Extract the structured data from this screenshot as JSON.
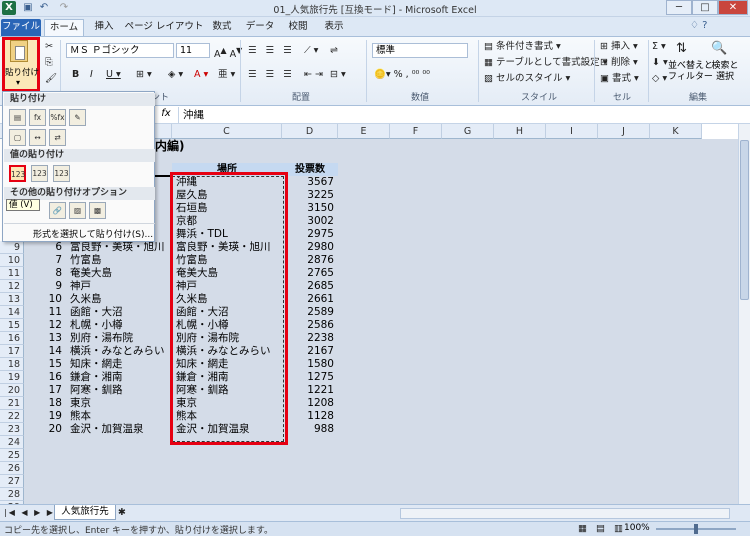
{
  "window": {
    "title": "01_人気旅行先 [互換モード] - Microsoft Excel",
    "logo": "X",
    "controls": [
      "─",
      "□",
      "✕"
    ]
  },
  "tabs": [
    "ファイル",
    "ホーム",
    "挿入",
    "ページ レイアウト",
    "数式",
    "データ",
    "校閲",
    "表示"
  ],
  "ribbon": {
    "paste_label": "貼り付け",
    "font_name": "ＭＳ Ｐゴシック",
    "font_size": "11",
    "number_format": "標準",
    "conditional_format": "条件付き書式",
    "format_as_table": "テーブルとして書式設定",
    "cell_styles": "セルのスタイル",
    "insert": "挿入",
    "delete": "削除",
    "format": "書式",
    "sort_filter": "並べ替えと\nフィルター",
    "find_select": "検索と\n選択",
    "groups": {
      "font": "フォント",
      "alignment": "配置",
      "number": "数値",
      "styles": "スタイル",
      "cells": "セル",
      "editing": "編集"
    }
  },
  "formula_bar": {
    "fx": "fx",
    "content": "沖縄"
  },
  "paste_menu": {
    "header_paste": "貼り付け",
    "header_values": "値の貼り付け",
    "header_other": "その他の貼り付けオプション",
    "tooltip": "値 (V)",
    "special": "形式を選択して貼り付け(S)...",
    "value_icons": [
      "123",
      "123",
      "123"
    ]
  },
  "sheet": {
    "columns": [
      "C",
      "D",
      "E",
      "F",
      "G",
      "H",
      "I",
      "J",
      "K"
    ],
    "title_fragment": "内編)",
    "header_place": "場所",
    "header_votes": "投票数",
    "rows_top": [
      {
        "row": "",
        "rank": "",
        "a": "",
        "place": "沖縄",
        "votes": "3567"
      },
      {
        "row": "",
        "rank": "",
        "a": "",
        "place": "屋久島",
        "votes": "3225"
      },
      {
        "row": "",
        "rank": "",
        "a": "",
        "place": "石垣島",
        "votes": "3150"
      },
      {
        "row": "",
        "rank": "",
        "a": "",
        "place": "京都",
        "votes": "3002"
      },
      {
        "row": "",
        "rank": "",
        "a": "",
        "place": "舞浜・TDL",
        "votes": "2975"
      }
    ],
    "rows": [
      {
        "row": "9",
        "rank": "6",
        "a": "富良野・美瑛・旭川",
        "place": "富良野・美瑛・旭川",
        "votes": "2980"
      },
      {
        "row": "10",
        "rank": "7",
        "a": "竹富島",
        "place": "竹富島",
        "votes": "2876"
      },
      {
        "row": "11",
        "rank": "8",
        "a": "奄美大島",
        "place": "奄美大島",
        "votes": "2765"
      },
      {
        "row": "12",
        "rank": "9",
        "a": "神戸",
        "place": "神戸",
        "votes": "2685"
      },
      {
        "row": "13",
        "rank": "10",
        "a": "久米島",
        "place": "久米島",
        "votes": "2661"
      },
      {
        "row": "14",
        "rank": "11",
        "a": "函館・大沼",
        "place": "函館・大沼",
        "votes": "2589"
      },
      {
        "row": "15",
        "rank": "12",
        "a": "札幌・小樽",
        "place": "札幌・小樽",
        "votes": "2586"
      },
      {
        "row": "16",
        "rank": "13",
        "a": "別府・湯布院",
        "place": "別府・湯布院",
        "votes": "2238"
      },
      {
        "row": "17",
        "rank": "14",
        "a": "横浜・みなとみらい",
        "place": "横浜・みなとみらい",
        "votes": "2167"
      },
      {
        "row": "18",
        "rank": "15",
        "a": "知床・網走",
        "place": "知床・網走",
        "votes": "1580"
      },
      {
        "row": "19",
        "rank": "16",
        "a": "鎌倉・湘南",
        "place": "鎌倉・湘南",
        "votes": "1275"
      },
      {
        "row": "20",
        "rank": "17",
        "a": "阿寒・釧路",
        "place": "阿寒・釧路",
        "votes": "1221"
      },
      {
        "row": "21",
        "rank": "18",
        "a": "東京",
        "place": "東京",
        "votes": "1208"
      },
      {
        "row": "22",
        "rank": "19",
        "a": "熊本",
        "place": "熊本",
        "votes": "1128"
      },
      {
        "row": "23",
        "rank": "20",
        "a": "金沢・加賀温泉",
        "place": "金沢・加賀温泉",
        "votes": "988"
      }
    ],
    "empty_rows": [
      "24",
      "25",
      "26",
      "27",
      "28",
      "29"
    ]
  },
  "sheet_tab": "人気旅行先",
  "status": {
    "message": "コピー先を選択し、Enter キーを押すか、貼り付けを選択します。",
    "zoom": "100%"
  },
  "colors": {
    "highlight": "#e60012",
    "file_tab": "#2a66b7",
    "header_fill": "#c5d9f1"
  }
}
